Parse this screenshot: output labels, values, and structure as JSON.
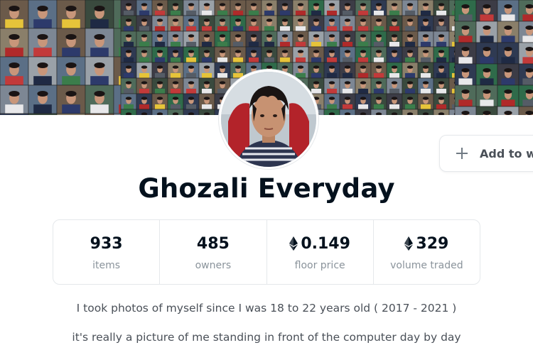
{
  "collection": {
    "name": "Ghozali Everyday",
    "watchlist_label": "Add to w",
    "stats": [
      {
        "value": "933",
        "label": "items",
        "eth": false
      },
      {
        "value": "485",
        "label": "owners",
        "eth": false
      },
      {
        "value": "0.149",
        "label": "floor price",
        "eth": true
      },
      {
        "value": "329",
        "label": "volume traded",
        "eth": true
      }
    ],
    "description": [
      "I took photos of myself since I was 18 to 22 years old ( 2017 - 2021 )",
      "it's really a picture of me standing in front of the computer day by day"
    ]
  },
  "icons": {
    "watchlist": "plus-icon",
    "currency": "ethereum-icon"
  },
  "colors": {
    "title": "#04111d",
    "label": "#8a939b",
    "border": "#e5e8eb",
    "text": "#4a5058"
  }
}
